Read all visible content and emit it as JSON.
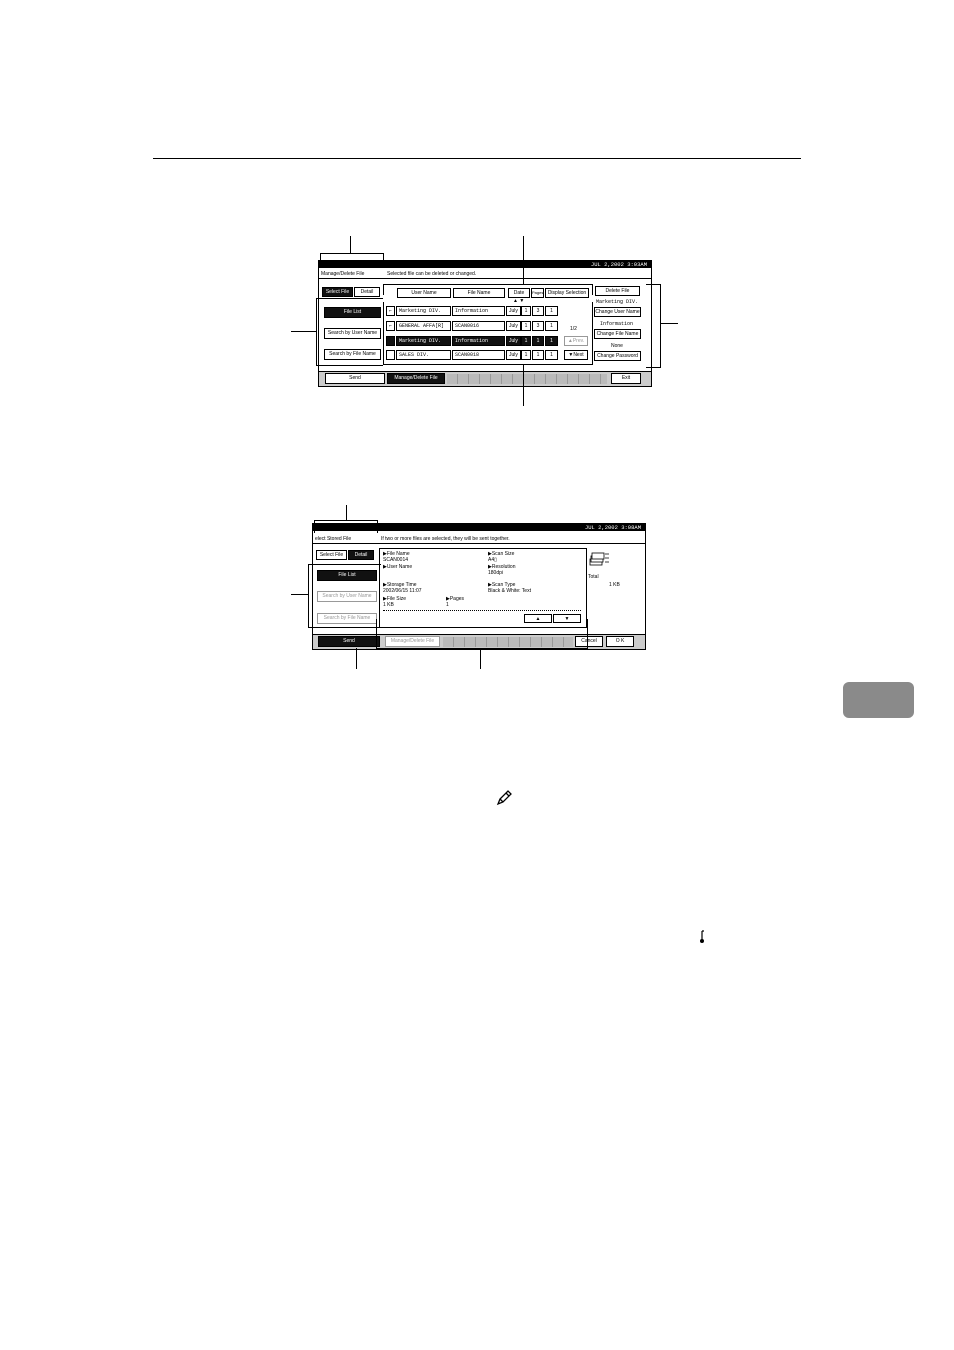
{
  "screen1": {
    "clock": "JUL   2,2002  3:03AM",
    "header_left": "Manage/Delete File",
    "header_msg": "Selected file can be deleted or changed.",
    "tabs": [
      "Select File",
      "Detail"
    ],
    "left_buttons": [
      "File List",
      "Search by User Name",
      "Search by File Name"
    ],
    "columns": [
      "User Name",
      "File Name",
      "Date",
      "Pages",
      "Display Selection"
    ],
    "sort_arrows": "▲ ▼",
    "rows": [
      {
        "icon": "",
        "user": "Marketing DIV.",
        "file": "Information",
        "date": "July",
        "d1": "1",
        "d2": "3",
        "pages": "1"
      },
      {
        "icon": "",
        "user": "GENERAL AFFA[R]",
        "file": "SCAN0016",
        "date": "July",
        "d1": "1",
        "d2": "3",
        "pages": "1"
      },
      {
        "icon": "",
        "user": "Marketing DIV.",
        "file": "Information",
        "date": "July",
        "d1": "1",
        "d2": "1",
        "pages": "1"
      },
      {
        "icon": "",
        "user": "SALES DIV.",
        "file": "SCAN0018",
        "date": "July",
        "d1": "1",
        "d2": "1",
        "pages": "1"
      }
    ],
    "page_indicator": "1/2",
    "prev_label": "▲Prev.",
    "next_label": "▼Next",
    "right_buttons": {
      "delete": "Delete File",
      "user_value": "Marketing DIV.",
      "change_user": "Change User Name",
      "file_value": "Information",
      "change_file": "Change File Name",
      "pw_value": "None",
      "change_pw": "Change Password"
    },
    "bottom_send": "Send",
    "bottom_manage": "Manage/Delete File",
    "exit": "Exit"
  },
  "screen2": {
    "clock": "JUL   2,2002  3:08AM",
    "header_left": "elect Stored File",
    "header_msg": "If two or more files are selected, they will be sent together.",
    "tabs": [
      "Select File",
      "Detail"
    ],
    "left_buttons": [
      "File List",
      "Search by User Name",
      "Search by File Name"
    ],
    "detail": {
      "file_name_label": "▶File Name",
      "file_name": "SCAN0014",
      "user_name_label": "▶User Name",
      "storage_time_label": "▶Storage Time",
      "storage_time": "2002/06/15  11:07",
      "file_size_label": "▶File Size",
      "file_size": "1 KB",
      "pages_label": "▶Pages",
      "pages": "1",
      "scan_size_label": "▶Scan Size",
      "scan_size": "A4▯",
      "resolution_label": "▶Resolution",
      "resolution": "180dpi",
      "scan_type_label": "▶Scan Type",
      "scan_type": "Black & White: Text"
    },
    "up_arrow": "▲",
    "down_arrow": "▼",
    "total_label": "Total",
    "total_value": "1 KB",
    "send": "Send",
    "manage": "Manage/Delete File",
    "cancel": "Cancel",
    "ok": "O K"
  },
  "colors": {
    "tab_marker": "#8a8a8a",
    "screen_bar": "#000000",
    "bottom_bar": "#cccccc"
  }
}
